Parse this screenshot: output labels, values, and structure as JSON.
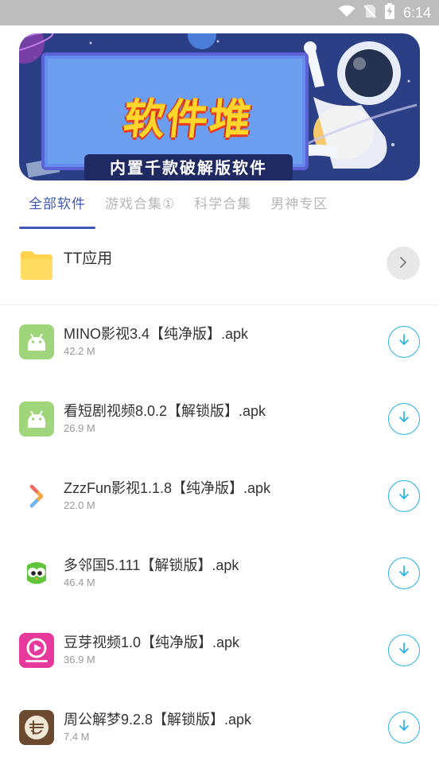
{
  "status_bar": {
    "time": "6:14",
    "icons": [
      "wifi-icon",
      "no-sim-icon",
      "battery-charging-icon"
    ]
  },
  "banner": {
    "title": "软件堆",
    "subtitle": "内置千款破解版软件",
    "colors": {
      "background": "#2a3f86",
      "panel": "#6c9ef0",
      "title": "#ffd52e",
      "title_outline": "#ea3b1d"
    }
  },
  "tabs": {
    "items": [
      {
        "label": "全部软件",
        "active": true
      },
      {
        "label": "游戏合集①",
        "active": false
      },
      {
        "label": "科学合集",
        "active": false
      },
      {
        "label": "男神专区",
        "active": false
      }
    ],
    "active_color": "#3f57b7",
    "inactive_color": "#b7b7b7"
  },
  "folder": {
    "title": "TT应用",
    "icon": "folder-icon"
  },
  "apps": {
    "items": [
      {
        "name": "MINO影视3.4【纯净版】.apk",
        "size": "42.2 M",
        "icon": "android-icon"
      },
      {
        "name": "看短剧视频8.0.2【解锁版】.apk",
        "size": "26.9 M",
        "icon": "android-icon"
      },
      {
        "name": "ZzzFun影视1.1.8【纯净版】.apk",
        "size": "22.0 M",
        "icon": "zzzfun-logo-icon"
      },
      {
        "name": "多邻国5.111【解锁版】.apk",
        "size": "46.4 M",
        "icon": "duolingo-owl-icon"
      },
      {
        "name": "豆芽视频1.0【纯净版】.apk",
        "size": "36.9 M",
        "icon": "douya-video-icon"
      },
      {
        "name": "周公解梦9.2.8【解锁版】.apk",
        "size": "7.4 M",
        "icon": "zhougong-dream-icon"
      }
    ],
    "accent": "#29b2e8"
  }
}
